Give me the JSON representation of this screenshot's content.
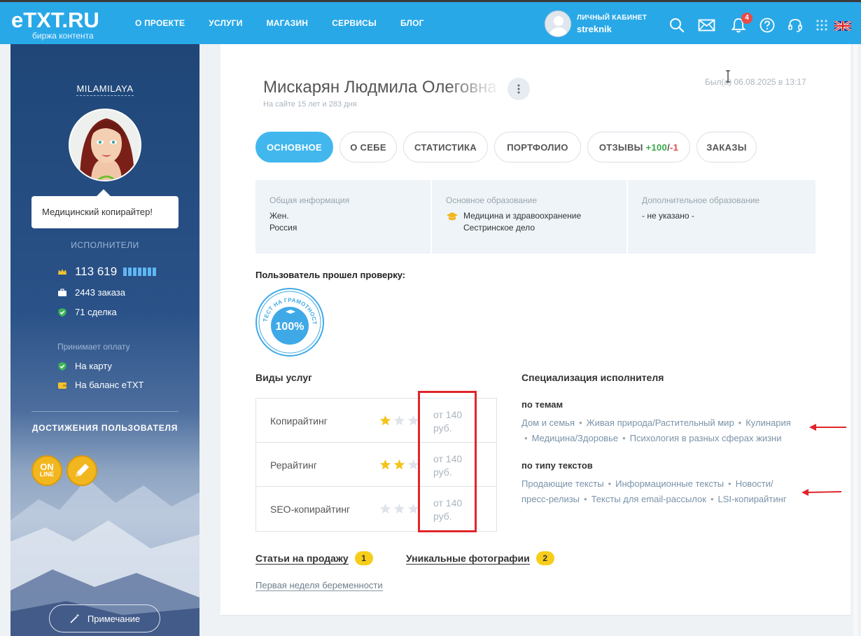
{
  "header": {
    "logo_text": "eTXT.RU",
    "logo_subtitle": "биржа контента",
    "nav": [
      "О ПРОЕКТЕ",
      "УСЛУГИ",
      "МАГАЗИН",
      "СЕРВИСЫ",
      "БЛОГ"
    ],
    "account_label": "ЛИЧНЫЙ КАБИНЕТ",
    "account_user": "streknik",
    "notifications_count": "4",
    "accent_color": "#29a8e8"
  },
  "sidebar": {
    "username": "MILAMILAYA",
    "status_text": "Медицинский копирайтер!",
    "role_title": "ИСПОЛНИТЕЛИ",
    "rating": "113 619",
    "orders": "2443 заказа",
    "deals": "71 сделка",
    "payment_title": "Принимает оплату",
    "payment_methods": [
      "На карту",
      "На баланс eTXT"
    ],
    "achievements_title": "ДОСТИЖЕНИЯ ПОЛЬЗОВАТЕЛЯ",
    "achievement_online": [
      "ON",
      "LINE"
    ],
    "note_button": "Примечание"
  },
  "profile": {
    "name": "Мискарян Людмила Олеговна",
    "on_site": "На сайте 15 лет и 283 дня",
    "last_seen": "Был(а) 06.08.2025 в 13:17",
    "tabs": {
      "main": "ОСНОВНОЕ",
      "about": "О СЕБЕ",
      "stats": "СТАТИСТИКА",
      "portfolio": "ПОРТФОЛИО",
      "reviews": "ОТЗЫВЫ",
      "reviews_pos": "+100",
      "reviews_slash": "/",
      "reviews_neg": "-1",
      "orders": "ЗАКАЗЫ"
    },
    "info": {
      "general_label": "Общая информация",
      "general_lines": [
        "Жен.",
        "Россия"
      ],
      "education_label": "Основное образование",
      "education_lines": [
        "Медицина и здравоохранение",
        "Сестринское дело"
      ],
      "extra_label": "Дополнительное образование",
      "extra_value": "- не указано -"
    },
    "verified_title": "Пользователь прошел проверку:",
    "seal": {
      "ring_text": "ТЕСТ НА ГРАМОТНОСТЬ",
      "value": "100%"
    }
  },
  "services": {
    "title": "Виды услуг",
    "rows": [
      {
        "name": "Копирайтинг",
        "stars": 1,
        "price": [
          "от 140",
          "руб."
        ]
      },
      {
        "name": "Рерайтинг",
        "stars": 2,
        "price": [
          "от 140",
          "руб."
        ]
      },
      {
        "name": "SEO-копирайтинг",
        "stars": 0,
        "price": [
          "от 140",
          "руб."
        ]
      }
    ]
  },
  "specialization": {
    "title": "Специализация исполнителя",
    "topics_title": "по темам",
    "topics_line1": [
      "Дом и семья",
      "Живая природа/Растительный мир",
      "Кулинария"
    ],
    "topics_line2": [
      "Медицина/Здоровье",
      "Психология в разных сферах жизни"
    ],
    "types_title": "по типу текстов",
    "types_line1": [
      "Продающие тексты",
      "Информационные тексты",
      "Новости/"
    ],
    "types_line2": [
      "пресс-релизы",
      "Тексты для email-рассылок",
      "LSI-копирайтинг"
    ]
  },
  "links": {
    "articles_label": "Статьи на продажу",
    "articles_count": "1",
    "photos_label": "Уникальные фотографии",
    "photos_count": "2",
    "article_link": "Первая неделя беременности"
  },
  "icons": [
    "search-icon",
    "mail-icon",
    "bell-icon",
    "help-icon",
    "headset-icon",
    "grid-icon",
    "uk-flag-icon",
    "crown-icon",
    "briefcase-icon",
    "shield-check-icon",
    "wallet-icon",
    "pencil-icon",
    "magic-wand-icon",
    "graduation-cap-icon",
    "star-icon",
    "more-vertical-icon"
  ]
}
